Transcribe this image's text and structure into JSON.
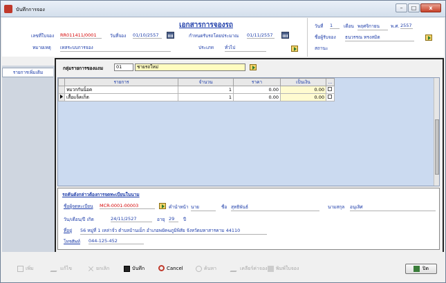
{
  "window": {
    "title": "บันทึกการจอง",
    "minimize": "–",
    "maximize": "□",
    "close": "x"
  },
  "document_title": "เอกสารการจองรถ",
  "header": {
    "booking_no_label": "เลขที่ใบจอง",
    "booking_no": "RR011411/0001",
    "booking_date_label": "วันที่จอง",
    "booking_date": "01/10/2557",
    "due_date_label": "กำหนดรับรถโดยประมาณ",
    "due_date": "01/11/2557",
    "remark_label": "หมายเหตุ",
    "remark": "เทสระบบการจอง",
    "type_label": "ประเภท",
    "type_value": "ทั่วไป",
    "date_label": "วันที่",
    "day": "1",
    "month_label": "เดือน",
    "month": "พฤศจิกายน",
    "year_label": "พ.ศ.",
    "year": "2557",
    "receiver_label": "ชื่อผู้รับจอง",
    "receiver": "ธนวรรณ ทรงสมิต",
    "status_label": "สถานะ"
  },
  "side_tab": "รายการเพิ่มเติม",
  "group": {
    "label": "กลุ่มรายการของแถม",
    "code": "01",
    "name": "ชายรถใหม่"
  },
  "grid": {
    "columns": [
      "รายการ",
      "จำนวน",
      "ราคา",
      "เป็นเงิน",
      "..."
    ],
    "rows": [
      {
        "item": "หมวกกันน็อค",
        "qty": "1",
        "price": "0.00",
        "amount": "0.00"
      },
      {
        "item": "เสื้อแจ็คเก็ต",
        "qty": "1",
        "price": "0.00",
        "amount": "0.00"
      }
    ]
  },
  "customer": {
    "section_title": "รถคันดังกล่าวต้องการจดทะเบียนในนาม",
    "customer_code_label": "ชื่อผู้จดทะเบียน",
    "customer_code": "MCR-0001-00003",
    "prefix_label": "คำนำหน้า",
    "prefix": "นาย",
    "firstname_label": "ชื่อ",
    "firstname": "สุทธิพันธ์",
    "lastname_label": "นามสกุล",
    "lastname": "อนุเลิศ",
    "birthdate_label": "วัน/เดือน/ปี เกิด",
    "birthdate": "24/11/2527",
    "age_label": "อายุ",
    "age": "29",
    "age_unit": "ปี",
    "address_label": "ที่อยู่",
    "address": "56 หมู่ที่ 1 เหล่าจั่ว ตำบลบ้านเม็ก อำเภอพยัคฆภูมิพิสัย จังหวัดมหาสารคาม 44110",
    "phone_label": "โทรศัพท์",
    "phone": "044-125-452"
  },
  "toolbar": {
    "add": "เพิ่ม",
    "edit": "แก้ไข",
    "remove": "ยกเลิก",
    "save": "บันทึก",
    "cancel": "Cancel",
    "search": "ค้นหา",
    "clear": "เคลียร์ค่าจอง",
    "print": "พิมพ์ใบจอง",
    "close": "ปิด"
  }
}
